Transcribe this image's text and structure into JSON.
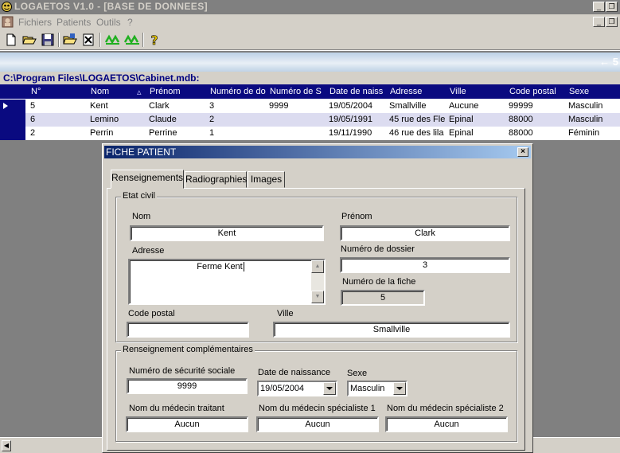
{
  "window": {
    "title": "LOGAETOS V1.0 - [BASE DE DONNEES]",
    "min_glyph": "_",
    "restore_glyph": "❐"
  },
  "menu": {
    "items": [
      "Fichiers",
      "Patients",
      "Outils",
      "?"
    ]
  },
  "nav": {
    "arrow": "← 5"
  },
  "path": "C:\\Program Files\\LOGAETOS\\Cabinet.mdb:",
  "grid": {
    "sort_indicator": "▵",
    "columns": [
      "N°",
      "Nom",
      "Prénom",
      "Numéro de do",
      "Numéro de S",
      "Date de naiss",
      "Adresse",
      "Ville",
      "Code postal",
      "Sexe"
    ],
    "rows": [
      [
        "5",
        "Kent",
        "Clark",
        "3",
        "9999",
        "19/05/2004",
        "Smallville",
        "Aucune",
        "99999",
        "Masculin"
      ],
      [
        "6",
        "Lemino",
        "Claude",
        "2",
        "",
        "19/05/1991",
        "45 rue des Fle",
        "Epinal",
        "88000",
        "Masculin"
      ],
      [
        "2",
        "Perrin",
        "Perrine",
        "1",
        "",
        "19/11/1990",
        "46 rue des lila",
        "Epinal",
        "88000",
        "Féminin"
      ]
    ]
  },
  "dialog": {
    "title": "FICHE PATIENT",
    "close_glyph": "×",
    "tabs": [
      "Renseignements",
      "Radiographies",
      "Images"
    ],
    "etat_civil": {
      "legend": "Etat civil",
      "nom_label": "Nom",
      "nom_value": "Kent",
      "prenom_label": "Prénom",
      "prenom_value": "Clark",
      "adresse_label": "Adresse",
      "adresse_value": "Ferme Kent",
      "numero_dossier_label": "Numéro de dossier",
      "numero_dossier_value": "3",
      "numero_fiche_label": "Numéro de la fiche",
      "numero_fiche_value": "5",
      "code_postal_label": "Code postal",
      "code_postal_value": "",
      "ville_label": "Ville",
      "ville_value": "Smallville"
    },
    "complementaires": {
      "legend": "Renseignement complémentaires",
      "secu_label": "Numéro de sécurité sociale",
      "secu_value": "9999",
      "naissance_label": "Date de naissance",
      "naissance_value": "19/05/2004",
      "sexe_label": "Sexe",
      "sexe_value": "Masculin",
      "medecin_traitant_label": "Nom du médecin traitant",
      "medecin_traitant_value": "Aucun",
      "specialiste1_label": "Nom du médecin spécialiste 1",
      "specialiste1_value": "Aucun",
      "specialiste2_label": "Nom du médecin spécialiste 2",
      "specialiste2_value": "Aucun"
    }
  },
  "colors": {
    "grid_header": "#0a0a80",
    "workspace": "#808080",
    "face": "#d4d0c8"
  }
}
